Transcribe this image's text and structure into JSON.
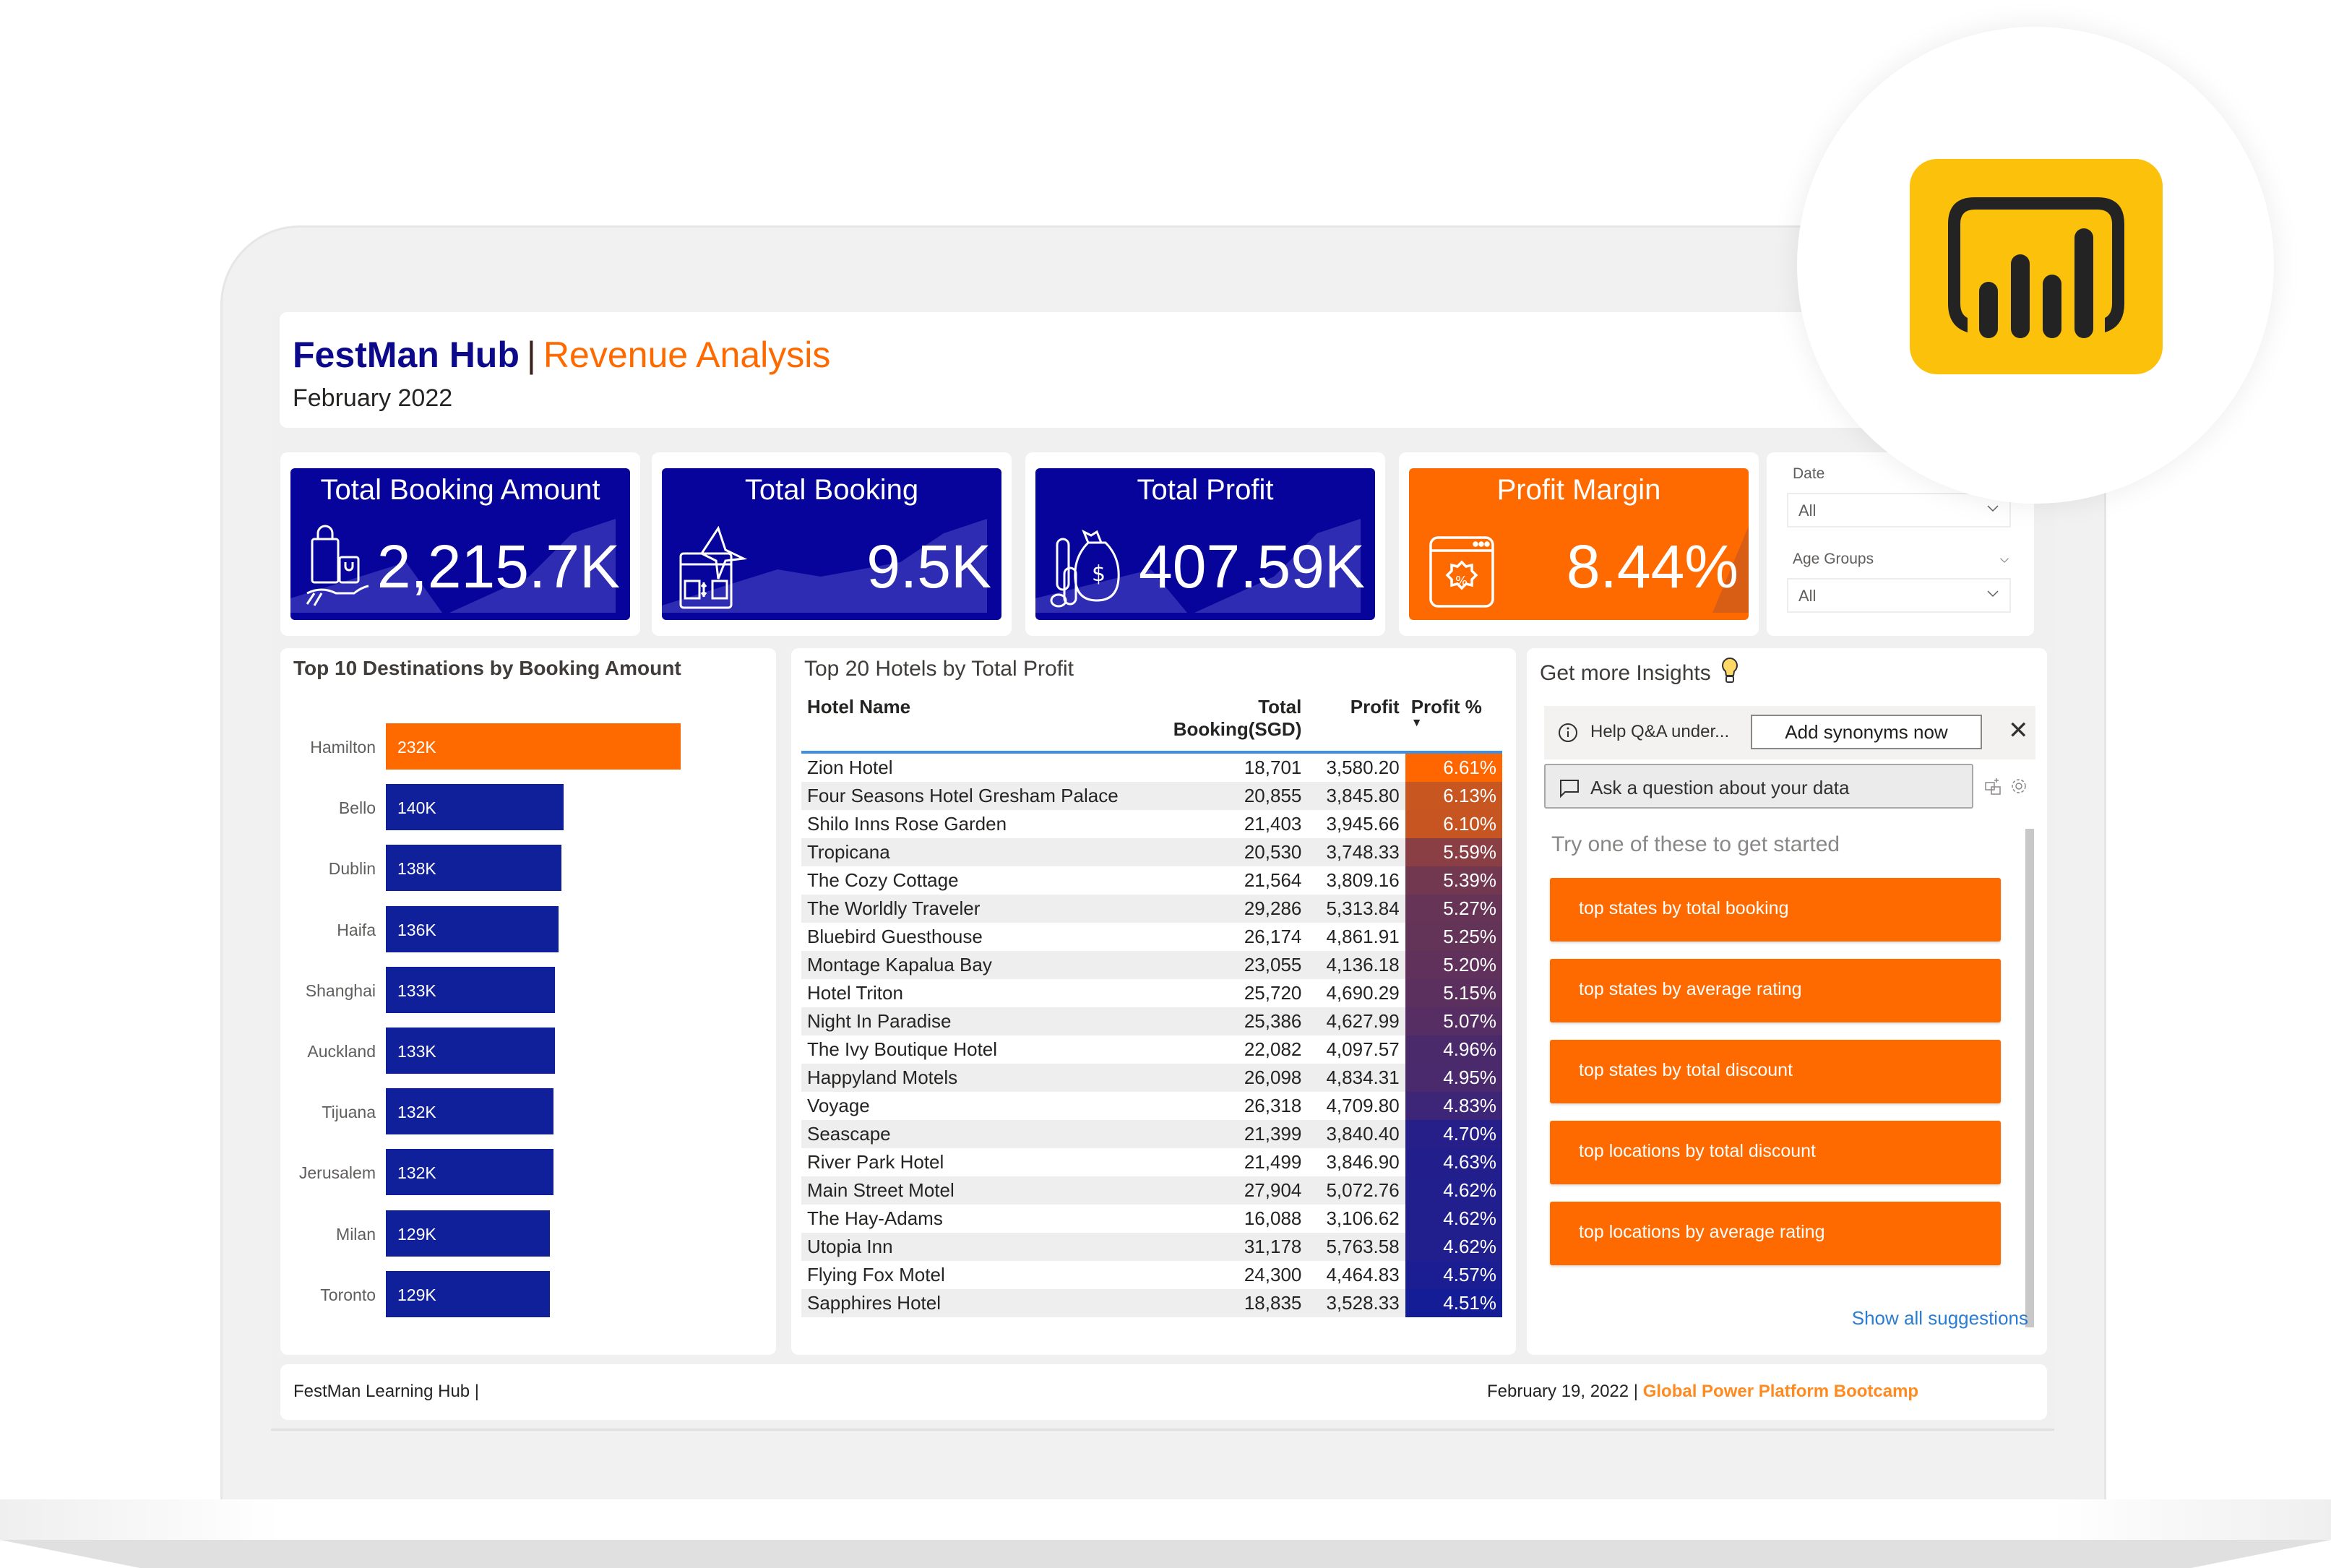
{
  "header": {
    "brand": "FestMan Hub",
    "separator": "|",
    "page_title": "Revenue Analysis",
    "period": "February 2022"
  },
  "kpis": [
    {
      "label": "Total Booking Amount",
      "value": "2,215.7K",
      "icon": "shopping-bags-hand-icon",
      "color": "#06049a"
    },
    {
      "label": "Total Booking",
      "value": "9.5K",
      "icon": "plane-booking-icon",
      "color": "#06049a"
    },
    {
      "label": "Total Profit",
      "value": "407.59K",
      "icon": "money-bag-coins-icon",
      "color": "#06049a"
    },
    {
      "label": "Profit Margin",
      "value": "8.44%",
      "icon": "percent-badge-window-icon",
      "color": "#ff6a00"
    }
  ],
  "slicers": {
    "date": {
      "label": "Date",
      "selected": "All"
    },
    "age_groups": {
      "label": "Age Groups",
      "selected": "All"
    }
  },
  "destinations": {
    "title": "Top 10 Destinations by Booking Amount"
  },
  "chart_data": {
    "type": "bar",
    "orientation": "horizontal",
    "title": "Top 10 Destinations by Booking Amount",
    "categories": [
      "Hamilton",
      "Bello",
      "Dublin",
      "Haifa",
      "Shanghai",
      "Auckland",
      "Tijuana",
      "Jerusalem",
      "Milan",
      "Toronto"
    ],
    "values": [
      232,
      140,
      138,
      136,
      133,
      133,
      132,
      132,
      129,
      129
    ],
    "value_labels": [
      "232K",
      "140K",
      "138K",
      "136K",
      "133K",
      "133K",
      "132K",
      "132K",
      "129K",
      "129K"
    ],
    "units": "K",
    "highlight_color": "#ff6a00",
    "bar_color": "#10209a",
    "xlim": [
      0,
      232
    ],
    "grid": false,
    "xlabel": "",
    "ylabel": ""
  },
  "hotels": {
    "title": "Top 20 Hotels by Total Profit",
    "columns": [
      "Hotel Name",
      "Total Booking(SGD)",
      "Profit",
      "Profit %"
    ],
    "sort_indicator": "▼",
    "rows": [
      {
        "name": "Zion Hotel",
        "booking": "18,701",
        "profit": "3,580.20",
        "pct": "6.61%",
        "color": "#ff6600"
      },
      {
        "name": "Four Seasons Hotel Gresham Palace",
        "booking": "20,855",
        "profit": "3,845.80",
        "pct": "6.13%",
        "color": "#c85621"
      },
      {
        "name": "Shilo Inns Rose Garden",
        "booking": "21,403",
        "profit": "3,945.66",
        "pct": "6.10%",
        "color": "#c65522"
      },
      {
        "name": "Tropicana",
        "booking": "20,530",
        "profit": "3,748.33",
        "pct": "5.59%",
        "color": "#8a3f44"
      },
      {
        "name": "The Cozy Cottage",
        "booking": "21,564",
        "profit": "3,809.16",
        "pct": "5.39%",
        "color": "#723850"
      },
      {
        "name": "The Worldly Traveler",
        "booking": "29,286",
        "profit": "5,313.84",
        "pct": "5.27%",
        "color": "#663457"
      },
      {
        "name": "Bluebird Guesthouse",
        "booking": "26,174",
        "profit": "4,861.91",
        "pct": "5.25%",
        "color": "#643358"
      },
      {
        "name": "Montage Kapalua Bay",
        "booking": "23,055",
        "profit": "4,136.18",
        "pct": "5.20%",
        "color": "#60325b"
      },
      {
        "name": "Hotel Triton",
        "booking": "25,720",
        "profit": "4,690.29",
        "pct": "5.15%",
        "color": "#5c305e"
      },
      {
        "name": "Night In Paradise",
        "booking": "25,386",
        "profit": "4,627.99",
        "pct": "5.07%",
        "color": "#562e63"
      },
      {
        "name": "The Ivy Boutique Hotel",
        "booking": "22,082",
        "profit": "4,097.57",
        "pct": "4.96%",
        "color": "#4b2a6c"
      },
      {
        "name": "Happyland Motels",
        "booking": "26,098",
        "profit": "4,834.31",
        "pct": "4.95%",
        "color": "#4a2a6d"
      },
      {
        "name": "Voyage",
        "booking": "26,318",
        "profit": "4,709.80",
        "pct": "4.83%",
        "color": "#3d2578"
      },
      {
        "name": "Seascape",
        "booking": "21,399",
        "profit": "3,840.40",
        "pct": "4.70%",
        "color": "#261f8a"
      },
      {
        "name": "River Park Hotel",
        "booking": "21,499",
        "profit": "3,846.90",
        "pct": "4.63%",
        "color": "#221f8d"
      },
      {
        "name": "Main Street Motel",
        "booking": "27,904",
        "profit": "5,072.76",
        "pct": "4.62%",
        "color": "#211f8e"
      },
      {
        "name": "The Hay-Adams",
        "booking": "16,088",
        "profit": "3,106.62",
        "pct": "4.62%",
        "color": "#211f8e"
      },
      {
        "name": "Utopia Inn",
        "booking": "31,178",
        "profit": "5,763.58",
        "pct": "4.62%",
        "color": "#211f8e"
      },
      {
        "name": "Flying Fox Motel",
        "booking": "24,300",
        "profit": "4,464.83",
        "pct": "4.57%",
        "color": "#1b1e92"
      },
      {
        "name": "Sapphires Hotel",
        "booking": "18,835",
        "profit": "3,528.33",
        "pct": "4.51%",
        "color": "#141d96"
      }
    ]
  },
  "insights": {
    "title": "Get more Insights",
    "help_text": "Help Q&A under...",
    "add_synonyms_label": "Add synonyms now",
    "close_glyph": "✕",
    "ask_placeholder": "Ask a question about your data",
    "try_text": "Try one of these to get started",
    "suggestions": [
      "top states by total booking",
      "top states by average rating",
      "top states by total discount",
      "top locations by total discount",
      "top locations by average rating"
    ],
    "show_all_label": "Show all suggestions"
  },
  "footer": {
    "left": "FestMan Learning Hub |",
    "date": "February 19, 2022 |",
    "event": "Global Power Platform Bootcamp"
  },
  "colors": {
    "navy": "#06049a",
    "orange": "#ff6a00",
    "powerbi_yellow": "#fcc10a"
  }
}
